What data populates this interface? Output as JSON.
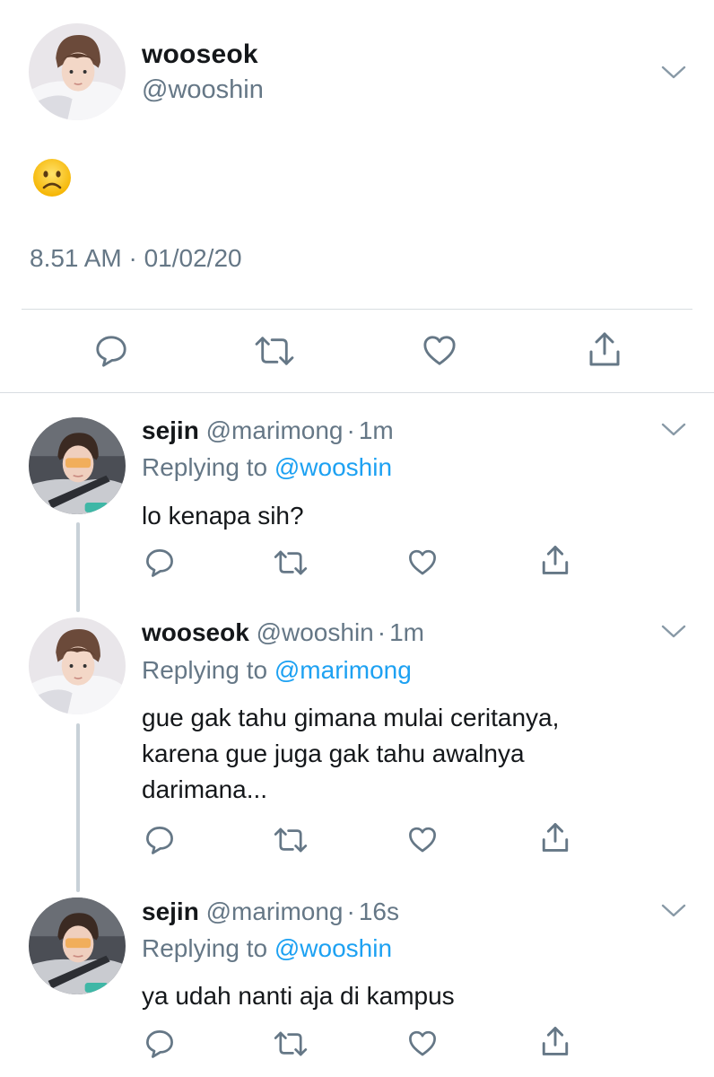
{
  "main_tweet": {
    "display_name": "wooseok",
    "handle": "@wooshin",
    "content_emoji": "frowning-face-emoji",
    "timestamp": "8.51 AM · 01/02/20",
    "actions": [
      "reply-icon",
      "retweet-icon",
      "like-icon",
      "share-icon"
    ],
    "menu_icon": "chevron-down-icon"
  },
  "replies": [
    {
      "display_name": "sejin",
      "handle": "@marimong",
      "separator": "·",
      "time": "1m",
      "replying_label": "Replying to",
      "replying_to": "@wooshin",
      "text": "lo kenapa sih?"
    },
    {
      "display_name": "wooseok",
      "handle": "@wooshin",
      "separator": "·",
      "time": "1m",
      "replying_label": "Replying to",
      "replying_to": "@marimong",
      "text": "gue gak tahu gimana mulai ceritanya, karena gue juga gak tahu awalnya darimana..."
    },
    {
      "display_name": "sejin",
      "handle": "@marimong",
      "separator": "·",
      "time": "16s",
      "replying_label": "Replying to",
      "replying_to": "@wooshin",
      "text": "ya udah nanti aja di kampus"
    }
  ],
  "colors": {
    "text_primary": "#14171a",
    "text_secondary": "#657786",
    "link": "#1da1f2",
    "divider": "#d8dde1",
    "thread_line": "#c8d1d8"
  }
}
